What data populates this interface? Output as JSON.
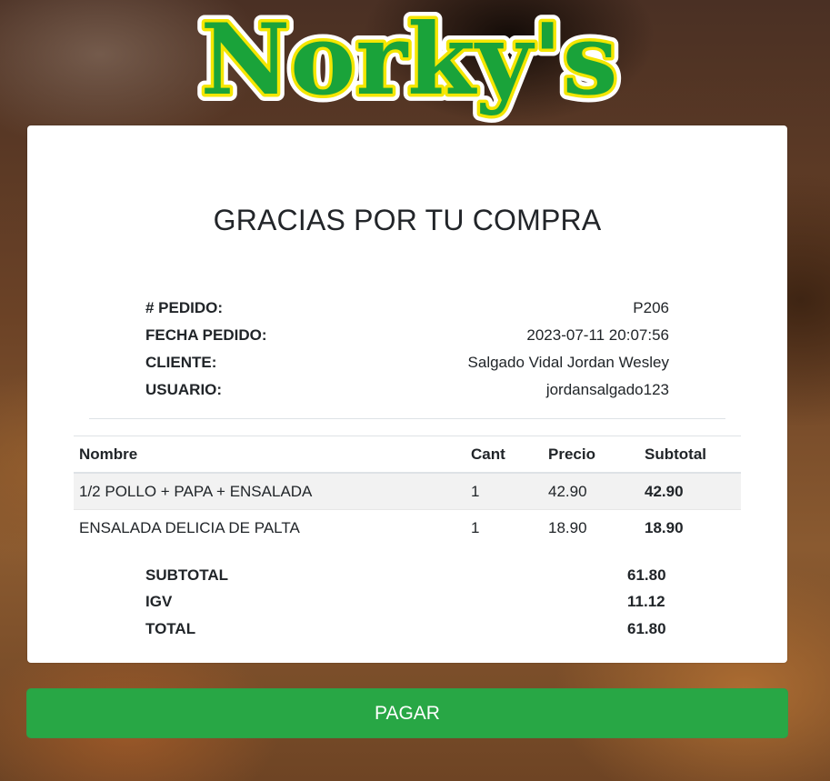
{
  "brand": {
    "logo_text": "Norky's"
  },
  "receipt": {
    "title": "GRACIAS POR TU COMPRA",
    "info": [
      {
        "label": "# PEDIDO:",
        "value": "P206"
      },
      {
        "label": "FECHA PEDIDO:",
        "value": "2023-07-11 20:07:56"
      },
      {
        "label": "CLIENTE:",
        "value": "Salgado Vidal Jordan Wesley"
      },
      {
        "label": "USUARIO:",
        "value": "jordansalgado123"
      }
    ],
    "table": {
      "headers": [
        "Nombre",
        "Cant",
        "Precio",
        "Subtotal"
      ],
      "rows": [
        [
          "1/2 POLLO + PAPA + ENSALADA",
          "1",
          "42.90",
          "42.90"
        ],
        [
          "ENSALADA DELICIA DE PALTA",
          "1",
          "18.90",
          "18.90"
        ]
      ]
    },
    "totals": [
      {
        "label": "SUBTOTAL",
        "value": "61.80"
      },
      {
        "label": "IGV",
        "value": "11.12"
      },
      {
        "label": "TOTAL",
        "value": "61.80"
      }
    ]
  },
  "actions": {
    "pay_label": "PAGAR"
  },
  "colors": {
    "accent": "#28a745",
    "logo_green": "#1aa33a",
    "logo_yellow": "#f4e600"
  }
}
